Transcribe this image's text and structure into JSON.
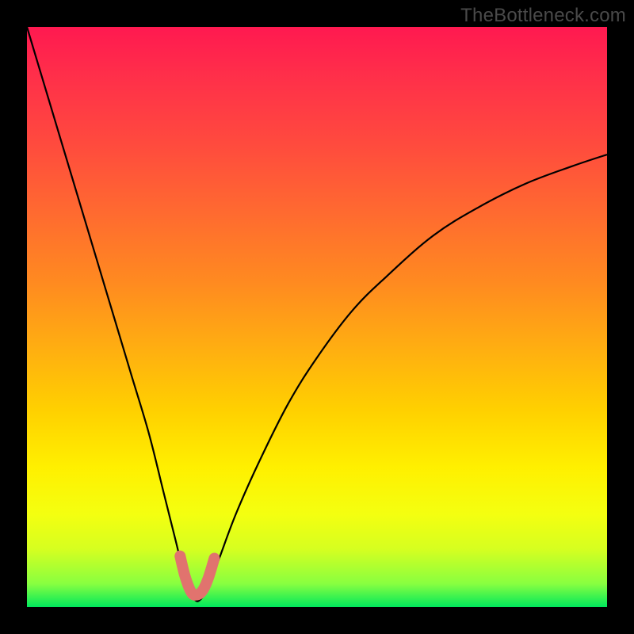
{
  "watermark": {
    "text": "TheBottleneck.com"
  },
  "chart_data": {
    "type": "line",
    "title": "",
    "xlabel": "",
    "ylabel": "",
    "xlim": [
      0,
      100
    ],
    "ylim": [
      0,
      100
    ],
    "series": [
      {
        "name": "main-curve",
        "stroke": "#000000",
        "stroke_width": 2.2,
        "x": [
          0,
          3,
          6,
          9,
          12,
          15,
          18,
          21,
          23.5,
          25.5,
          27,
          28.2,
          29,
          29.8,
          31,
          33,
          36,
          40,
          45,
          50,
          56,
          62,
          70,
          78,
          86,
          94,
          100
        ],
        "y": [
          100,
          90,
          80,
          70,
          60,
          50,
          40,
          30,
          20,
          12,
          6,
          2.5,
          1.2,
          1.2,
          3,
          8,
          16,
          25,
          35,
          43,
          51,
          57,
          64,
          69,
          73,
          76,
          78
        ]
      },
      {
        "name": "trough-marker",
        "stroke": "#e1736e",
        "stroke_width": 14,
        "linecap": "round",
        "x": [
          26.4,
          27.2,
          28.0,
          28.6,
          29.2,
          29.9,
          30.6,
          31.4,
          32.3
        ],
        "y": [
          8.8,
          5.5,
          3.2,
          2.2,
          2.1,
          2.4,
          3.4,
          5.4,
          8.4
        ]
      }
    ]
  }
}
